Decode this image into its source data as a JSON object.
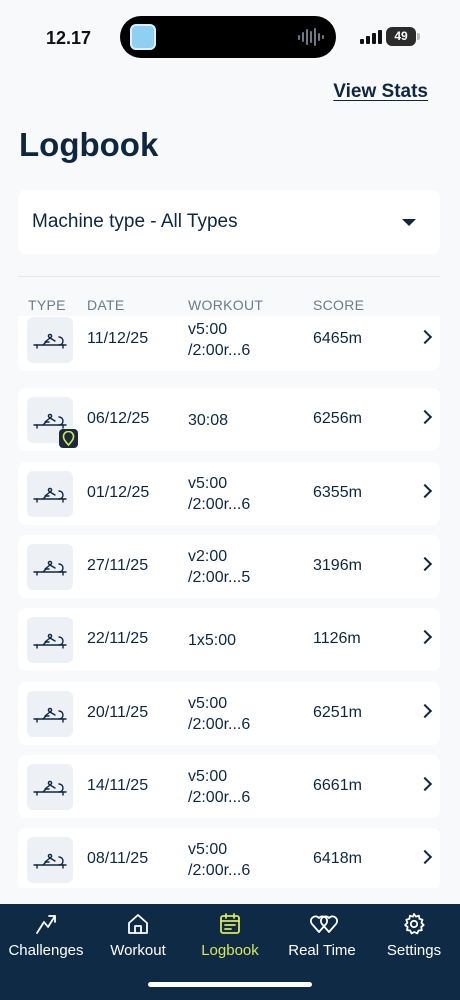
{
  "status_bar": {
    "time": "12.17",
    "battery": "49"
  },
  "header": {
    "view_stats_label": "View Stats",
    "title": "Logbook"
  },
  "filter": {
    "label": "Machine type -  All Types"
  },
  "table": {
    "columns": [
      "TYPE",
      "DATE",
      "WORKOUT",
      "SCORE"
    ],
    "rows": [
      {
        "date": "11/12/25",
        "workout_line1": "v5:00",
        "workout_line2": "/2:00r...6",
        "score": "6465m",
        "badge": false
      },
      {
        "date": "06/12/25",
        "workout_line1": "30:08",
        "workout_line2": "",
        "score": "6256m",
        "badge": true
      },
      {
        "date": "01/12/25",
        "workout_line1": "v5:00",
        "workout_line2": "/2:00r...6",
        "score": "6355m",
        "badge": false
      },
      {
        "date": "27/11/25",
        "workout_line1": "v2:00",
        "workout_line2": "/2:00r...5",
        "score": "3196m",
        "badge": false
      },
      {
        "date": "22/11/25",
        "workout_line1": "1x5:00",
        "workout_line2": "",
        "score": "1126m",
        "badge": false
      },
      {
        "date": "20/11/25",
        "workout_line1": "v5:00",
        "workout_line2": "/2:00r...6",
        "score": "6251m",
        "badge": false
      },
      {
        "date": "14/11/25",
        "workout_line1": "v5:00",
        "workout_line2": "/2:00r...6",
        "score": "6661m",
        "badge": false
      },
      {
        "date": "08/11/25",
        "workout_line1": "v5:00",
        "workout_line2": "/2:00r...6",
        "score": "6418m",
        "badge": false
      }
    ]
  },
  "tabbar": {
    "tabs": [
      {
        "label": "Challenges",
        "icon": "challenges-icon"
      },
      {
        "label": "Workout",
        "icon": "home-icon"
      },
      {
        "label": "Logbook",
        "icon": "logbook-icon",
        "active": true
      },
      {
        "label": "Real Time",
        "icon": "hearts-icon"
      },
      {
        "label": "Settings",
        "icon": "gear-icon"
      }
    ]
  },
  "colors": {
    "accent": "#d8e85a",
    "navy": "#0f2a44",
    "text": "#0e2740",
    "background": "#f7f9fb"
  }
}
